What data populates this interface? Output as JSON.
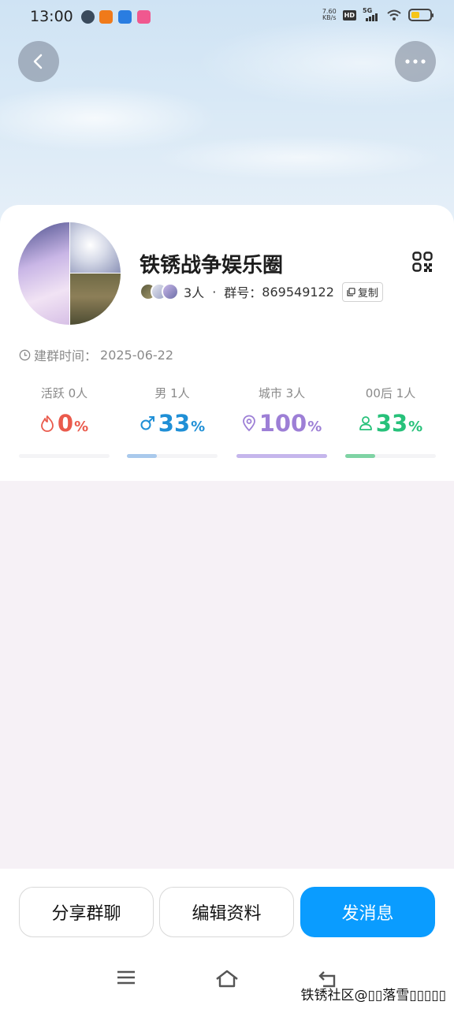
{
  "status_bar": {
    "time": "13:00",
    "net_speed_value": "7.60",
    "net_speed_unit": "KB/s",
    "hd": "HD",
    "network": "5G",
    "battery_level": 0.45,
    "battery_color": "#f5c518"
  },
  "header": {
    "back_icon": "chevron-left-icon",
    "more_icon": "ellipsis-icon"
  },
  "group": {
    "name": "铁锈战争娱乐圈",
    "member_count": "3人",
    "separator": "·",
    "group_id_label": "群号：",
    "group_id": "869549122",
    "copy_label": "复制",
    "created_label": "建群时间：",
    "created_date": "2025-06-22"
  },
  "stats": [
    {
      "label": "活跃 0人",
      "value": "0",
      "unit": "%",
      "icon": "flame-icon",
      "color": "#ea5a4c",
      "fill_fraction": 0.0
    },
    {
      "label": "男 1人",
      "value": "33",
      "unit": "%",
      "icon": "male-icon",
      "color": "#1f8fd6",
      "fill_fraction": 0.33
    },
    {
      "label": "城市 3人",
      "value": "100",
      "unit": "%",
      "icon": "location-pin-icon",
      "color": "#9d7fd6",
      "fill_fraction": 1.0
    },
    {
      "label": "00后 1人",
      "value": "33",
      "unit": "%",
      "icon": "person-icon",
      "color": "#27c17a",
      "fill_fraction": 0.33
    }
  ],
  "stat_bar_colors": [
    "#ea5a4c",
    "#a9c9ec",
    "#c5b6ec",
    "#7fd3a4"
  ],
  "actions": {
    "share": "分享群聊",
    "edit": "编辑资料",
    "message": "发消息"
  },
  "colors": {
    "primary": "#0a9cff"
  },
  "watermark": "铁锈社区@▯▯落雪▯▯▯▯▯"
}
